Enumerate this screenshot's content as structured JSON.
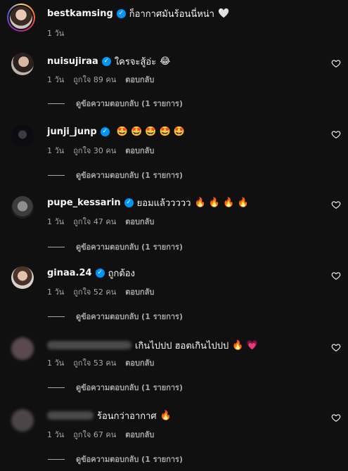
{
  "caption": {
    "username": "bestkamsing",
    "text": "ก็อากาศมันร้อนนี่หน่า",
    "emoji": "🤍",
    "time": "1 วัน"
  },
  "comments": [
    {
      "username": "nuisujiraa",
      "verified": true,
      "text": "ใครจะสู้อ่ะ",
      "emoji": "😂",
      "time": "1 วัน",
      "likes": "ถูกใจ 89 คน",
      "reply": "ตอบกลับ",
      "view_replies": "ดูข้อความตอบกลับ (1 รายการ)"
    },
    {
      "username": "junji_junp",
      "verified": true,
      "text": "",
      "emoji": "🤩 🤩 🤩 🤩 🤩",
      "time": "1 วัน",
      "likes": "ถูกใจ 30 คน",
      "reply": "ตอบกลับ",
      "view_replies": "ดูข้อความตอบกลับ (1 รายการ)"
    },
    {
      "username": "pupe_kessarin",
      "verified": true,
      "text": "ยอมแล้ววววว",
      "emoji": "🔥 🔥 🔥 🔥",
      "time": "1 วัน",
      "likes": "ถูกใจ 47 คน",
      "reply": "ตอบกลับ",
      "view_replies": "ดูข้อความตอบกลับ (1 รายการ)"
    },
    {
      "username": "ginaa.24",
      "verified": true,
      "text": "ถูกต้อง",
      "emoji": "",
      "time": "1 วัน",
      "likes": "ถูกใจ 52 คน",
      "reply": "ตอบกลับ",
      "view_replies": "ดูข้อความตอบกลับ (1 รายการ)"
    },
    {
      "username": "",
      "verified": false,
      "text": "เกินไปปป ฮอตเกินไปปป",
      "emoji": "🔥 💗",
      "time": "1 วัน",
      "likes": "ถูกใจ 53 คน",
      "reply": "ตอบกลับ",
      "view_replies": "ดูข้อความตอบกลับ (1 รายการ)"
    },
    {
      "username": "",
      "verified": false,
      "text": "ร้อนกว่าอากาศ",
      "emoji": "🔥",
      "time": "1 วัน",
      "likes": "ถูกใจ 67 คน",
      "reply": "ตอบกลับ",
      "view_replies": "ดูข้อความตอบกลับ (1 รายการ)"
    }
  ],
  "colors": {
    "background": "#101010",
    "verified": "#0095f6",
    "secondary_text": "#a8a8a8"
  }
}
